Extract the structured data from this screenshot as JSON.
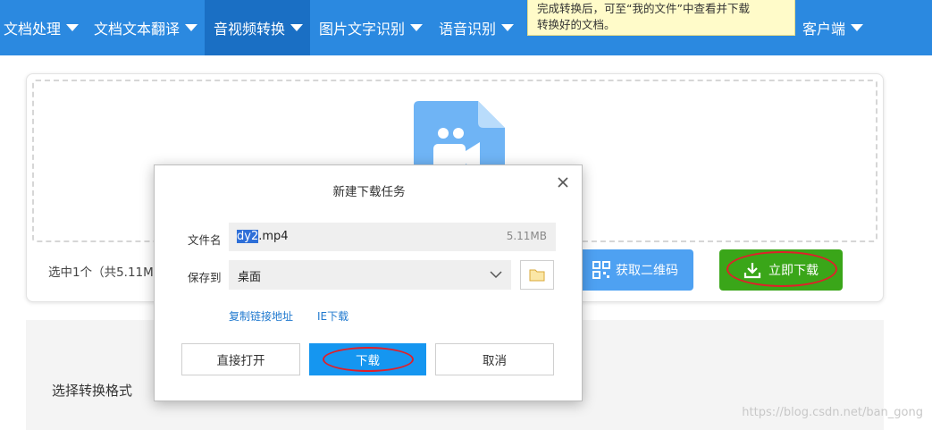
{
  "nav": {
    "items": [
      {
        "label": "文档处理"
      },
      {
        "label": "文档文本翻译"
      },
      {
        "label": "音视频转换"
      },
      {
        "label": "图片文字识别"
      },
      {
        "label": "语音识别"
      },
      {
        "label": "客户端"
      }
    ],
    "tooltip_line1": "完成转换后，可至“我的文件”中查看并下载",
    "tooltip_line2": "转换好的文档。"
  },
  "upload": {
    "selected_info": "选中1个（共5.11M",
    "qr_button": "获取二维码",
    "download_now_button": "立即下载"
  },
  "format": {
    "title": "选择转换格式"
  },
  "dialog": {
    "title": "新建下载任务",
    "filename_label": "文件名",
    "filename_selected": "dy2",
    "filename_rest": ".mp4",
    "file_size": "5.11MB",
    "save_to_label": "保存到",
    "save_to_value": "桌面",
    "copy_link": "复制链接地址",
    "ie_download": "IE下载",
    "open_directly": "直接打开",
    "download": "下载",
    "cancel": "取消"
  },
  "watermark": "https://blog.csdn.net/ban_gong",
  "colors": {
    "nav_bg": "#2b89e0",
    "nav_active": "#1a6fc4",
    "download_now_green": "#3aa619",
    "qr_blue": "#4ea1f2",
    "dialog_primary": "#1596f0",
    "annotation_red": "#e0202a"
  }
}
